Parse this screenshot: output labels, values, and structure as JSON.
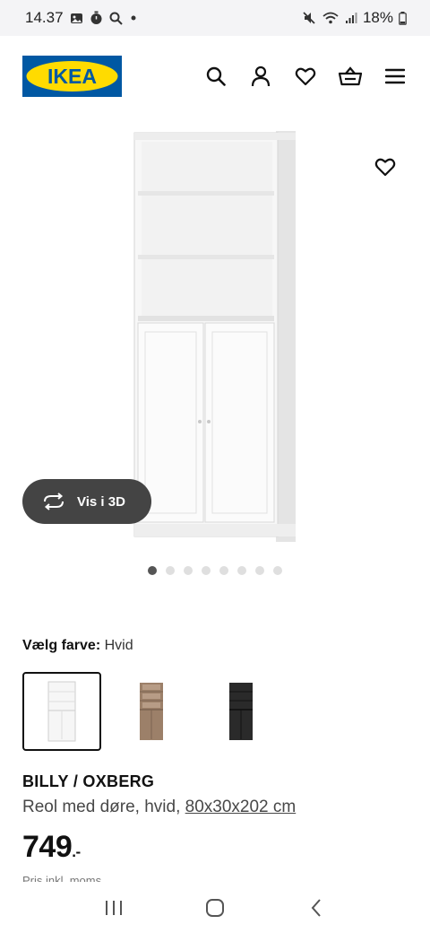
{
  "status_bar": {
    "time": "14.37",
    "battery": "18%",
    "icons": [
      "gallery-icon",
      "timer-icon",
      "search-icon",
      "dot-icon",
      "mute-icon",
      "wifi-icon",
      "signal-icon",
      "battery-icon"
    ]
  },
  "header": {
    "logo_text": "IKEA",
    "icons": [
      "search-icon",
      "account-icon",
      "wishlist-icon",
      "basket-icon",
      "menu-icon"
    ]
  },
  "gallery": {
    "view3d_label": "Vis i 3D",
    "image_count": 8,
    "active_index": 0
  },
  "color": {
    "label": "Vælg farve:",
    "value": "Hvid",
    "options": [
      "white",
      "oak-effect",
      "black"
    ]
  },
  "product": {
    "name": "BILLY / OXBERG",
    "description": "Reol med døre, hvid, ",
    "dimensions": "80x30x202 cm",
    "price": "749",
    "price_suffix": ".-",
    "price_note": "Pris inkl. moms"
  },
  "colors": {
    "ikea_blue": "#0058a3",
    "ikea_yellow": "#ffdb00",
    "pill_bg": "#444444"
  }
}
